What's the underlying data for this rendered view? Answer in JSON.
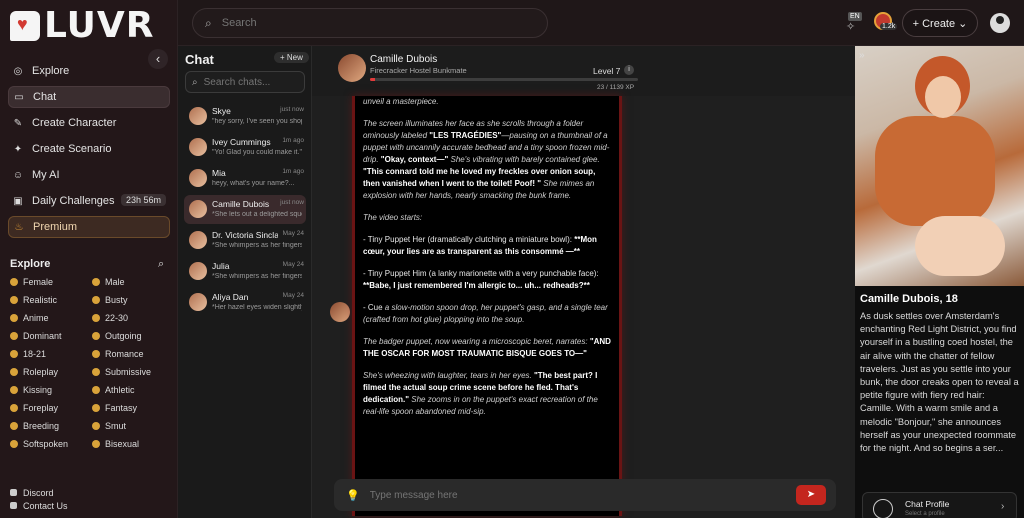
{
  "brand": {
    "name": "LUVR"
  },
  "sidebar": {
    "nav": [
      {
        "label": "Explore",
        "icon": "compass-icon"
      },
      {
        "label": "Chat",
        "icon": "chat-icon",
        "active": true
      },
      {
        "label": "Create Character",
        "icon": "wand-icon"
      },
      {
        "label": "Create Scenario",
        "icon": "scenario-icon"
      },
      {
        "label": "My AI",
        "icon": "robot-icon"
      },
      {
        "label": "Daily Challenges",
        "icon": "calendar-icon",
        "badge": "23h 56m"
      },
      {
        "label": "Premium",
        "icon": "flame-icon",
        "premium": true
      }
    ],
    "explore_title": "Explore",
    "tags": [
      "Female",
      "Male",
      "Realistic",
      "Busty",
      "Anime",
      "22-30",
      "Dominant",
      "Outgoing",
      "18-21",
      "Romance",
      "Roleplay",
      "Submissive",
      "Kissing",
      "Athletic",
      "Foreplay",
      "Fantasy",
      "Breeding",
      "Smut",
      "Softspoken",
      "Bisexual"
    ],
    "footer": [
      "Discord",
      "Contact Us"
    ]
  },
  "topbar": {
    "search_placeholder": "Search",
    "lang": "EN",
    "coins": "1.2k",
    "create_label": "+ Create ⌄"
  },
  "chatlist": {
    "title": "Chat",
    "new_label": "+ New",
    "search_placeholder": "Search chats...",
    "items": [
      {
        "name": "Skye",
        "preview": "\"hey sorry, I've seen you shop...",
        "time": "just now"
      },
      {
        "name": "Ivey Cummings",
        "preview": "\"Yo! Glad you could make it.\"...",
        "time": "1m ago"
      },
      {
        "name": "Mia",
        "preview": "heyy, what's your name?...",
        "time": "1m ago"
      },
      {
        "name": "Camille Dubois",
        "preview": "*She lets out a delighted sque...",
        "time": "just now",
        "active": true
      },
      {
        "name": "Dr. Victoria Sinclair",
        "preview": "*She whimpers as her fingers ...",
        "time": "May 24"
      },
      {
        "name": "Julia",
        "preview": "*She whimpers as her fingers ...",
        "time": "May 24"
      },
      {
        "name": "Aliya Dan",
        "preview": "*Her hazel eyes widen slightly ...",
        "time": "May 24"
      }
    ]
  },
  "chat": {
    "name": "Camille Dubois",
    "subtitle": "Firecracker Hostel Bunkmate",
    "level": "Level 7",
    "xp": "23 / 1139 XP",
    "xp_fraction": 0.02,
    "composer_placeholder": "Type message here",
    "message": {
      "p1_it": "unveil a masterpiece.",
      "p2_a": "The screen illuminates her face as she scrolls through a folder ominously labeled",
      "p2_b": "\"LES TRAGÉDIES\"",
      "p2_c": "—pausing on a thumbnail of a puppet with uncannily accurate bedhead and a tiny spoon frozen mid-drip.",
      "p2_d": "\"Okay, context—\"",
      "p2_e": "She's vibrating with barely contained glee.",
      "p2_f": "\"This connard told me he loved my freckles over onion soup, then vanished when I went to the toilet! Poof! \"",
      "p2_g": "She mimes an explosion with her hands, nearly smacking the bunk frame.",
      "p3": "The video starts:",
      "p4_a": "- Tiny Puppet Her (dramatically clutching a miniature bowl):",
      "p4_b": "**Mon cœur, your lies are as transparent as this consommé —**",
      "p5_a": "- Tiny Puppet Him (a lanky marionette with a very punchable face):",
      "p5_b": "**Babe, I just remembered I'm allergic to... uh... redheads?**",
      "p6_a": "- Cue",
      "p6_b": "a slow-motion spoon drop, her puppet's gasp, and a single tear (crafted from hot glue) plopping into the soup.",
      "p7_a": "The badger puppet, now wearing a microscopic beret, narrates:",
      "p7_b": "\"AND THE OSCAR FOR MOST TRAUMATIC BISQUE GOES TO—\"",
      "p8_a": "She's wheezing with laughter, tears in her eyes.",
      "p8_b": "\"The best part? I filmed the actual soup crime scene before he fled. That's dedication.\"",
      "p8_c": "She zooms in on the puppet's exact recreation of the real-life spoon abandoned mid-sip."
    }
  },
  "profile": {
    "name": "Camille Dubois, 18",
    "description": "As dusk settles over Amsterdam's enchanting Red Light District, you find yourself in a bustling coed hostel, the air alive with the chatter of fellow travelers. Just as you settle into your bunk, the door creaks open to reveal a petite figure with fiery red hair: Camille. With a warm smile and a melodic \"Bonjour,\" she announces herself as your unexpected roommate for the night. And so begins a ser...",
    "link_label": "Chat Profile",
    "link_sub": "Select a profile"
  },
  "colors": {
    "accent": "#c4261e",
    "premium": "#d9a33a",
    "bubble_border": "#6a1414"
  }
}
